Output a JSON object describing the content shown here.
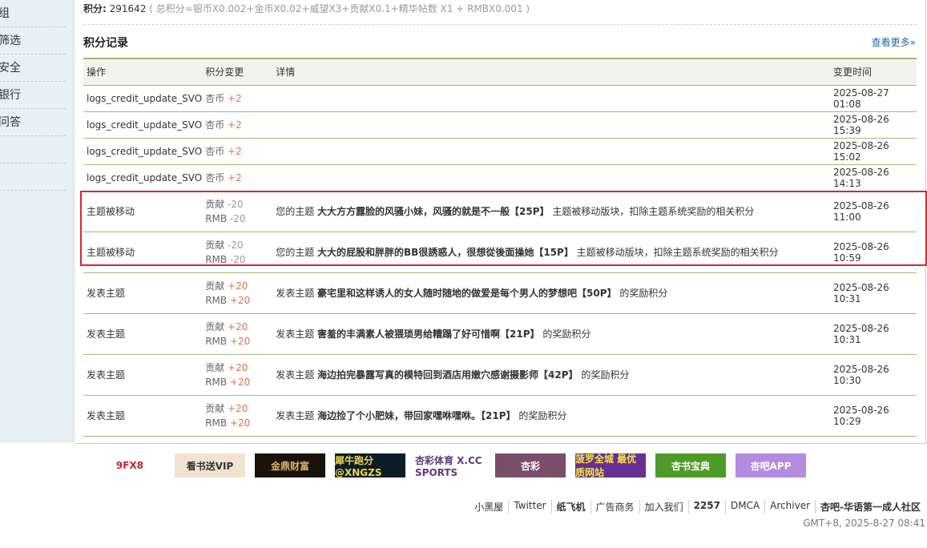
{
  "sidebar": {
    "items": [
      "组",
      "筛选",
      "安全",
      "银行",
      "问答",
      "",
      ""
    ]
  },
  "score": {
    "label": "积分:",
    "value": "291642",
    "formula": "( 总积分=银币X0.002+金币X0.02+威望X3+贡献X0.1+精华帖数 X1 + RMBX0.001 )"
  },
  "section": {
    "title": "积分记录",
    "more": "查看更多»"
  },
  "table": {
    "headers": [
      "操作",
      "积分变更",
      "详情",
      "变更时间"
    ],
    "rows": [
      {
        "op": "logs_credit_update_SVO",
        "c1": "杏币",
        "v1": "+2",
        "detail_pre": "",
        "detail_bold": "",
        "detail_post": "",
        "time": "2025-08-27 01:08"
      },
      {
        "op": "logs_credit_update_SVO",
        "c1": "杏币",
        "v1": "+2",
        "detail_pre": "",
        "detail_bold": "",
        "detail_post": "",
        "time": "2025-08-26 15:39"
      },
      {
        "op": "logs_credit_update_SVO",
        "c1": "杏币",
        "v1": "+2",
        "detail_pre": "",
        "detail_bold": "",
        "detail_post": "",
        "time": "2025-08-26 15:02"
      },
      {
        "op": "logs_credit_update_SVO",
        "c1": "杏币",
        "v1": "+2",
        "detail_pre": "",
        "detail_bold": "",
        "detail_post": "",
        "time": "2025-08-26 14:13"
      },
      {
        "op": "主题被移动",
        "c1": "贡献",
        "v1": "-20",
        "c2": "RMB",
        "v2": "-20",
        "detail_pre": "您的主题 ",
        "detail_bold": "大大方方露脸的风骚小妹，风骚的就是不一般【25P】",
        "detail_post": " 主题被移动版块，扣除主题系统奖励的相关积分",
        "time": "2025-08-26 11:00"
      },
      {
        "op": "主题被移动",
        "c1": "贡献",
        "v1": "-20",
        "c2": "RMB",
        "v2": "-20",
        "detail_pre": "您的主题 ",
        "detail_bold": "大大的屁股和胖胖的BB很誘惑人，很想從後面操她【15P】",
        "detail_post": " 主题被移动版块，扣除主题系统奖励的相关积分",
        "time": "2025-08-26 10:59"
      },
      {
        "op": "发表主题",
        "c1": "贡献",
        "v1": "+20",
        "c2": "RMB",
        "v2": "+20",
        "detail_pre": "发表主题 ",
        "detail_bold": "豪宅里和这样诱人的女人随时随地的做爱是每个男人的梦想吧【50P】",
        "detail_post": " 的奖励积分",
        "time": "2025-08-26 10:31"
      },
      {
        "op": "发表主题",
        "c1": "贡献",
        "v1": "+20",
        "c2": "RMB",
        "v2": "+20",
        "detail_pre": "发表主题 ",
        "detail_bold": "害羞的丰满素人被猥琐男给糟蹋了好可惜啊【21P】",
        "detail_post": " 的奖励积分",
        "time": "2025-08-26 10:31"
      },
      {
        "op": "发表主题",
        "c1": "贡献",
        "v1": "+20",
        "c2": "RMB",
        "v2": "+20",
        "detail_pre": "发表主题 ",
        "detail_bold": "海边拍完暴露写真的模特回到酒店用嫩穴感谢摄影师【42P】",
        "detail_post": " 的奖励积分",
        "time": "2025-08-26 10:30"
      },
      {
        "op": "发表主题",
        "c1": "贡献",
        "v1": "+20",
        "c2": "RMB",
        "v2": "+20",
        "detail_pre": "发表主题 ",
        "detail_bold": "海边捡了个小肥妹，带回家嘿咻嘿咻。【21P】",
        "detail_post": " 的奖励积分",
        "time": "2025-08-26 10:29"
      }
    ]
  },
  "banners": [
    {
      "text": "9FX8",
      "bg": "#fff",
      "fg": "#c0262c"
    },
    {
      "text": "看书送VIP",
      "bg": "#f0e4d0",
      "fg": "#333"
    },
    {
      "text": "金鼎财富",
      "bg": "#1a1208",
      "fg": "#d9b26a"
    },
    {
      "text": "犀牛跑分 @XNGZS",
      "bg": "#0c1d28",
      "fg": "#f2d34b"
    },
    {
      "text": "杏彩体育 X.CC SPORTS",
      "bg": "#fff",
      "fg": "#5b3d7a"
    },
    {
      "text": "杏彩",
      "bg": "#7a4e6a",
      "fg": "#fff"
    },
    {
      "text": "菠罗全城 最优质网站",
      "bg": "#6a2d96",
      "fg": "#f6e63c"
    },
    {
      "text": "杏书宝典",
      "bg": "#4e9a26",
      "fg": "#fff"
    },
    {
      "text": "杏吧APP",
      "bg": "#b38be0",
      "fg": "#fff"
    }
  ],
  "footer": {
    "links": [
      "小黑屋",
      "Twitter",
      "纸飞机",
      "广告商务",
      "加入我们",
      "2257",
      "DMCA",
      "Archiver",
      "杏吧-华语第一成人社区"
    ],
    "time": "GMT+8, 2025-8-27 08:41"
  }
}
